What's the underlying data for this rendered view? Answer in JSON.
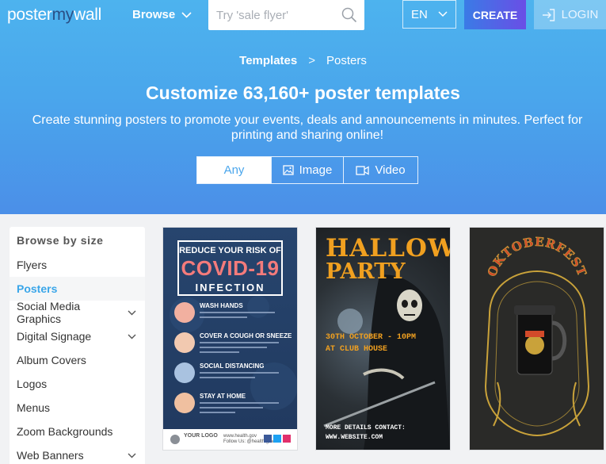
{
  "brand": {
    "logo_part1": "poster",
    "logo_part2": "my",
    "logo_part3": "wall"
  },
  "nav": {
    "browse_label": "Browse",
    "search_placeholder": "Try 'sale flyer'",
    "language": "EN",
    "create_label": "CREATE",
    "login_label": "LOGIN"
  },
  "breadcrumb": {
    "root": "Templates",
    "separator": ">",
    "current": "Posters"
  },
  "hero": {
    "title": "Customize 63,160+ poster templates",
    "subtitle": "Create stunning posters to promote your events, deals and announcements in minutes. Perfect for printing and sharing online!"
  },
  "filters": [
    {
      "label": "Any",
      "active": true
    },
    {
      "label": "Image",
      "icon": "image-icon"
    },
    {
      "label": "Video",
      "icon": "video-icon"
    }
  ],
  "sidebar": {
    "heading": "Browse by size",
    "items": [
      {
        "label": "Flyers"
      },
      {
        "label": "Posters",
        "active": true
      },
      {
        "label": "Social Media Graphics",
        "expandable": true
      },
      {
        "label": "Digital Signage",
        "expandable": true
      },
      {
        "label": "Album Covers"
      },
      {
        "label": "Logos"
      },
      {
        "label": "Menus"
      },
      {
        "label": "Zoom Backgrounds"
      },
      {
        "label": "Web Banners",
        "expandable": true
      }
    ]
  },
  "templates": {
    "covid": {
      "line1": "REDUCE YOUR RISK OF",
      "line2": "COVID-19",
      "line3": "INFECTION",
      "tips": [
        "WASH HANDS",
        "COVER A COUGH OR SNEEZE",
        "SOCIAL DISTANCING",
        "STAY AT HOME"
      ],
      "logo": "YOUR LOGO",
      "site": "www.health.gov",
      "follow": "Follow Us: @health.gov"
    },
    "halloween": {
      "line1": "HALLOWEEN",
      "line2": "PARTY",
      "date": "30TH OCTOBER - 10PM",
      "venue": "AT CLUB HOUSE",
      "contact": "MORE DETAILS CONTACT:",
      "website": "WWW.WEBSITE.COM"
    },
    "oktoberfest": {
      "title": "OKTOBERFEST"
    }
  },
  "colors": {
    "accent": "#3aa6e9",
    "create_start": "#3a7be6",
    "create_end": "#6a4ee6",
    "covid_red": "#f47b7b",
    "halloween_orange": "#f0a020",
    "okto_gold": "#c9a23a"
  }
}
